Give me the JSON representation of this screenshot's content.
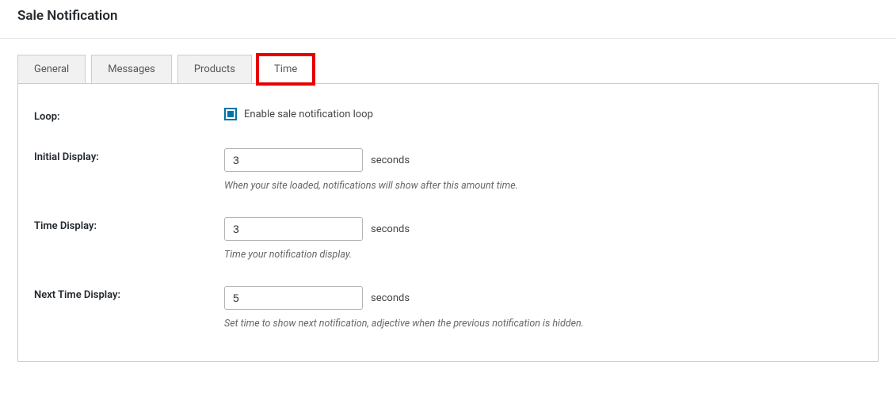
{
  "page": {
    "title": "Sale Notification"
  },
  "tabs": {
    "items": [
      {
        "label": "General"
      },
      {
        "label": "Messages"
      },
      {
        "label": "Products"
      },
      {
        "label": "Time"
      }
    ]
  },
  "form": {
    "loop": {
      "label": "Loop:",
      "checkbox_label": "Enable sale notification loop",
      "checked": true
    },
    "initial_display": {
      "label": "Initial Display:",
      "value": "3",
      "suffix": "seconds",
      "hint": "When your site loaded, notifications will show after this amount time."
    },
    "time_display": {
      "label": "Time Display:",
      "value": "3",
      "suffix": "seconds",
      "hint": "Time your notification display."
    },
    "next_time_display": {
      "label": "Next Time Display:",
      "value": "5",
      "suffix": "seconds",
      "hint": "Set time to show next notification, adjective when the previous notification is hidden."
    }
  }
}
